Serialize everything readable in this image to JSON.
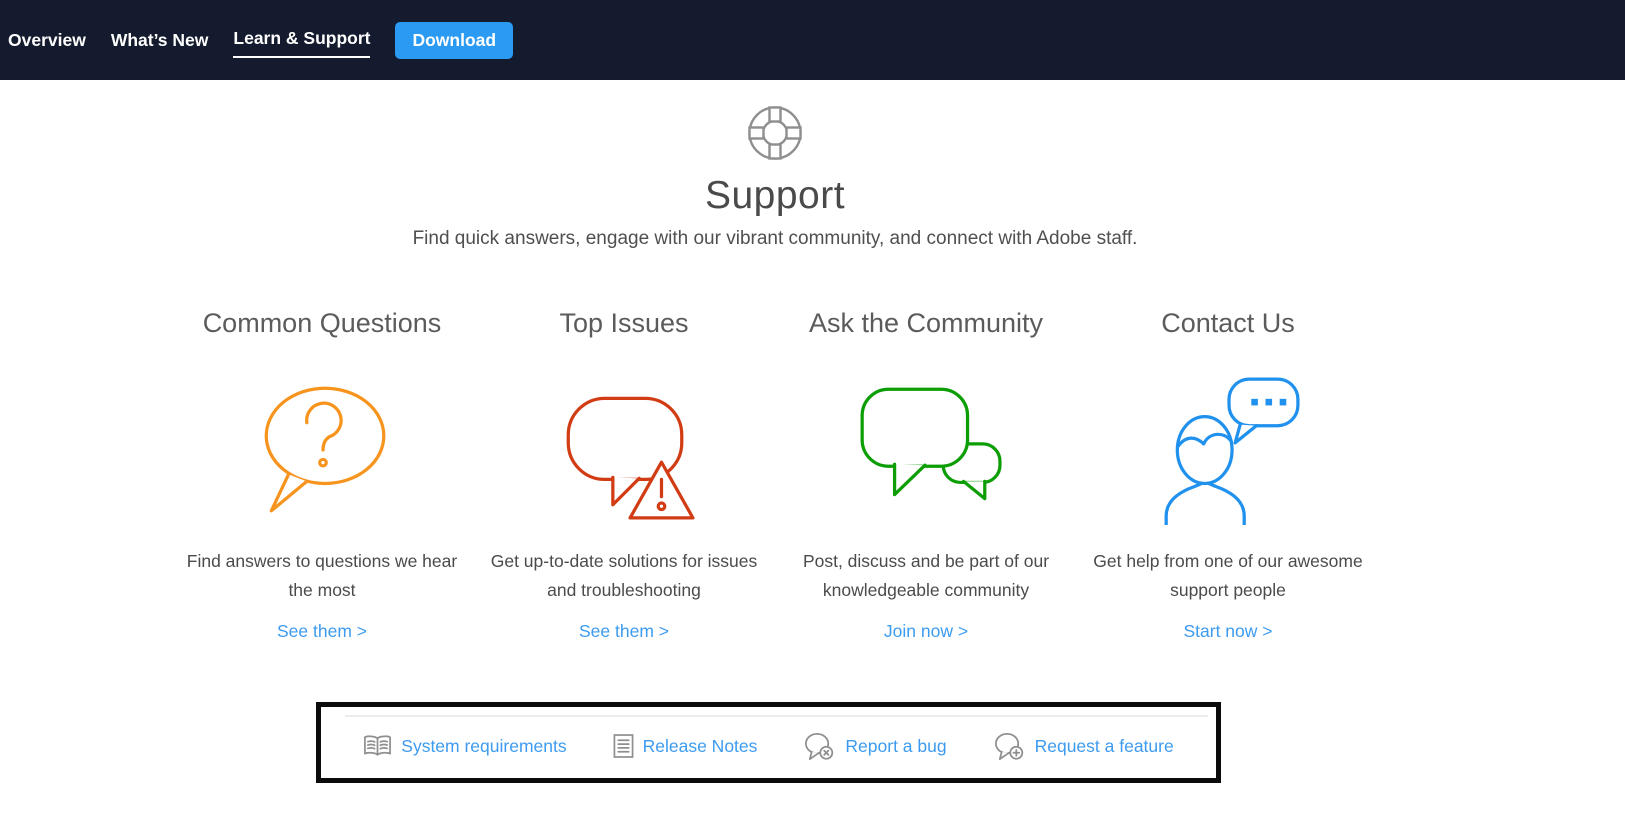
{
  "nav": {
    "items": [
      {
        "label": "Overview",
        "active": false
      },
      {
        "label": "What’s New",
        "active": false
      },
      {
        "label": "Learn & Support",
        "active": true
      }
    ],
    "download_label": "Download"
  },
  "hero": {
    "icon": "lifebuoy-icon",
    "title": "Support",
    "subtitle": "Find quick answers, engage with our vibrant community, and connect with Adobe staff."
  },
  "cards": [
    {
      "title": "Common Questions",
      "icon": "question-bubble-icon",
      "color": "#f7941e",
      "description": "Find answers to questions we hear the most",
      "link": "See them >"
    },
    {
      "title": "Top Issues",
      "icon": "warning-bubble-icon",
      "color": "#d23c14",
      "description": "Get up-to-date solutions for issues and troubleshooting",
      "link": "See them >"
    },
    {
      "title": "Ask the Community",
      "icon": "community-bubbles-icon",
      "color": "#0d9e06",
      "description": "Post, discuss and be part of our knowledgeable community",
      "link": "Join now >"
    },
    {
      "title": "Contact Us",
      "icon": "person-chat-icon",
      "color": "#2191ee",
      "description": "Get help from one of our awesome support people",
      "link": "Start now >"
    }
  ],
  "quicklinks": {
    "items": [
      {
        "label": "System requirements",
        "icon": "open-book-icon"
      },
      {
        "label": "Release Notes",
        "icon": "document-icon"
      },
      {
        "label": "Report a bug",
        "icon": "bubble-x-icon"
      },
      {
        "label": "Request a feature",
        "icon": "bubble-plus-icon"
      }
    ]
  },
  "colors": {
    "nav_bg": "#141b2e",
    "download_blue": "#2b9af2",
    "link_blue": "#3d9bef",
    "icon_gray": "#8f8f8f"
  }
}
